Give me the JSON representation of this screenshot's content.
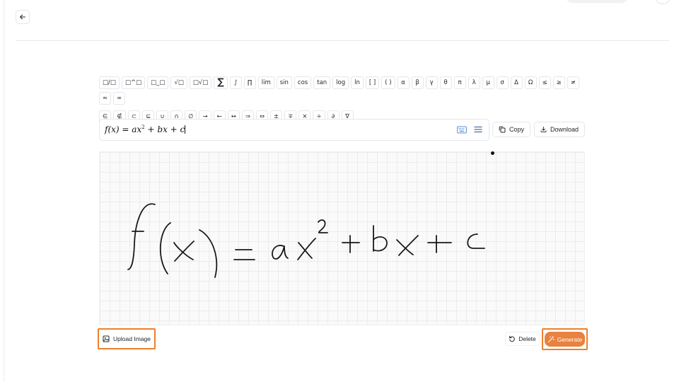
{
  "header": {
    "back_icon": "arrow-left-icon"
  },
  "toolbar": {
    "row1": [
      "□/□",
      "□^□",
      "□_□",
      "√□",
      "□√□",
      "∑",
      "∫",
      "∏",
      "lim",
      "sin",
      "cos",
      "tan",
      "log",
      "ln",
      "[ ]",
      "( )",
      "α",
      "β",
      "γ",
      "θ",
      "π",
      "λ",
      "μ",
      "σ",
      "Δ",
      "Ω",
      "≤",
      "≥",
      "≠",
      "≈",
      "∞"
    ],
    "row2": [
      "∈",
      "∉",
      "⊂",
      "⊆",
      "∪",
      "∩",
      "∅",
      "→",
      "←",
      "↔",
      "⇒",
      "⇔",
      "±",
      "∓",
      "×",
      "÷",
      "∂",
      "∇"
    ]
  },
  "formula": {
    "f": "f",
    "open": "(",
    "x": "x",
    "close": ")",
    "eq": " = ",
    "a": "a",
    "x2": "x",
    "exp": "2",
    "plus1": " + ",
    "b": "b",
    "x3": "x",
    "plus2": " + ",
    "c": "c",
    "keyboard_icon": "keyboard-icon",
    "menu_icon": "menu-icon"
  },
  "actions": {
    "copy_label": "Copy",
    "download_label": "Download",
    "upload_label": "Upload Image",
    "delete_label": "Delete",
    "generate_label": "Generate"
  },
  "colors": {
    "accent": "#e8823f",
    "highlight_border": "#ee7f2d",
    "grid": "#ececec"
  }
}
